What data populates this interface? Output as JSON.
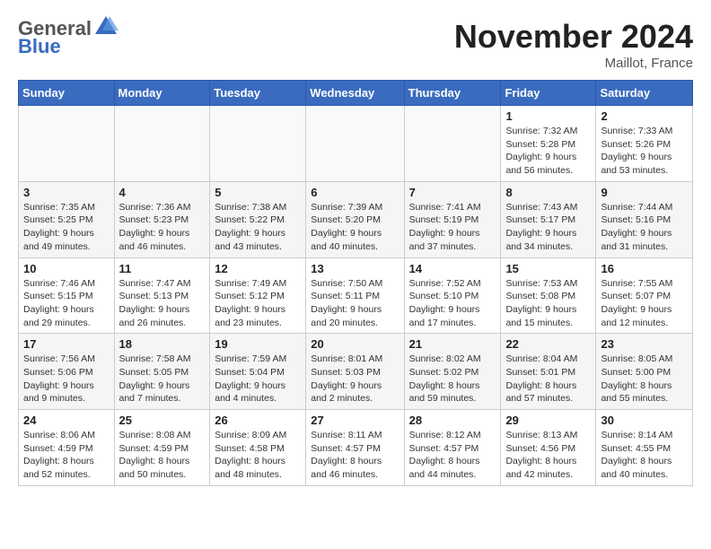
{
  "header": {
    "logo_general": "General",
    "logo_blue": "Blue",
    "month_title": "November 2024",
    "location": "Maillot, France"
  },
  "days_of_week": [
    "Sunday",
    "Monday",
    "Tuesday",
    "Wednesday",
    "Thursday",
    "Friday",
    "Saturday"
  ],
  "weeks": [
    [
      {
        "day": "",
        "info": ""
      },
      {
        "day": "",
        "info": ""
      },
      {
        "day": "",
        "info": ""
      },
      {
        "day": "",
        "info": ""
      },
      {
        "day": "",
        "info": ""
      },
      {
        "day": "1",
        "info": "Sunrise: 7:32 AM\nSunset: 5:28 PM\nDaylight: 9 hours\nand 56 minutes."
      },
      {
        "day": "2",
        "info": "Sunrise: 7:33 AM\nSunset: 5:26 PM\nDaylight: 9 hours\nand 53 minutes."
      }
    ],
    [
      {
        "day": "3",
        "info": "Sunrise: 7:35 AM\nSunset: 5:25 PM\nDaylight: 9 hours\nand 49 minutes."
      },
      {
        "day": "4",
        "info": "Sunrise: 7:36 AM\nSunset: 5:23 PM\nDaylight: 9 hours\nand 46 minutes."
      },
      {
        "day": "5",
        "info": "Sunrise: 7:38 AM\nSunset: 5:22 PM\nDaylight: 9 hours\nand 43 minutes."
      },
      {
        "day": "6",
        "info": "Sunrise: 7:39 AM\nSunset: 5:20 PM\nDaylight: 9 hours\nand 40 minutes."
      },
      {
        "day": "7",
        "info": "Sunrise: 7:41 AM\nSunset: 5:19 PM\nDaylight: 9 hours\nand 37 minutes."
      },
      {
        "day": "8",
        "info": "Sunrise: 7:43 AM\nSunset: 5:17 PM\nDaylight: 9 hours\nand 34 minutes."
      },
      {
        "day": "9",
        "info": "Sunrise: 7:44 AM\nSunset: 5:16 PM\nDaylight: 9 hours\nand 31 minutes."
      }
    ],
    [
      {
        "day": "10",
        "info": "Sunrise: 7:46 AM\nSunset: 5:15 PM\nDaylight: 9 hours\nand 29 minutes."
      },
      {
        "day": "11",
        "info": "Sunrise: 7:47 AM\nSunset: 5:13 PM\nDaylight: 9 hours\nand 26 minutes."
      },
      {
        "day": "12",
        "info": "Sunrise: 7:49 AM\nSunset: 5:12 PM\nDaylight: 9 hours\nand 23 minutes."
      },
      {
        "day": "13",
        "info": "Sunrise: 7:50 AM\nSunset: 5:11 PM\nDaylight: 9 hours\nand 20 minutes."
      },
      {
        "day": "14",
        "info": "Sunrise: 7:52 AM\nSunset: 5:10 PM\nDaylight: 9 hours\nand 17 minutes."
      },
      {
        "day": "15",
        "info": "Sunrise: 7:53 AM\nSunset: 5:08 PM\nDaylight: 9 hours\nand 15 minutes."
      },
      {
        "day": "16",
        "info": "Sunrise: 7:55 AM\nSunset: 5:07 PM\nDaylight: 9 hours\nand 12 minutes."
      }
    ],
    [
      {
        "day": "17",
        "info": "Sunrise: 7:56 AM\nSunset: 5:06 PM\nDaylight: 9 hours\nand 9 minutes."
      },
      {
        "day": "18",
        "info": "Sunrise: 7:58 AM\nSunset: 5:05 PM\nDaylight: 9 hours\nand 7 minutes."
      },
      {
        "day": "19",
        "info": "Sunrise: 7:59 AM\nSunset: 5:04 PM\nDaylight: 9 hours\nand 4 minutes."
      },
      {
        "day": "20",
        "info": "Sunrise: 8:01 AM\nSunset: 5:03 PM\nDaylight: 9 hours\nand 2 minutes."
      },
      {
        "day": "21",
        "info": "Sunrise: 8:02 AM\nSunset: 5:02 PM\nDaylight: 8 hours\nand 59 minutes."
      },
      {
        "day": "22",
        "info": "Sunrise: 8:04 AM\nSunset: 5:01 PM\nDaylight: 8 hours\nand 57 minutes."
      },
      {
        "day": "23",
        "info": "Sunrise: 8:05 AM\nSunset: 5:00 PM\nDaylight: 8 hours\nand 55 minutes."
      }
    ],
    [
      {
        "day": "24",
        "info": "Sunrise: 8:06 AM\nSunset: 4:59 PM\nDaylight: 8 hours\nand 52 minutes."
      },
      {
        "day": "25",
        "info": "Sunrise: 8:08 AM\nSunset: 4:59 PM\nDaylight: 8 hours\nand 50 minutes."
      },
      {
        "day": "26",
        "info": "Sunrise: 8:09 AM\nSunset: 4:58 PM\nDaylight: 8 hours\nand 48 minutes."
      },
      {
        "day": "27",
        "info": "Sunrise: 8:11 AM\nSunset: 4:57 PM\nDaylight: 8 hours\nand 46 minutes."
      },
      {
        "day": "28",
        "info": "Sunrise: 8:12 AM\nSunset: 4:57 PM\nDaylight: 8 hours\nand 44 minutes."
      },
      {
        "day": "29",
        "info": "Sunrise: 8:13 AM\nSunset: 4:56 PM\nDaylight: 8 hours\nand 42 minutes."
      },
      {
        "day": "30",
        "info": "Sunrise: 8:14 AM\nSunset: 4:55 PM\nDaylight: 8 hours\nand 40 minutes."
      }
    ]
  ]
}
